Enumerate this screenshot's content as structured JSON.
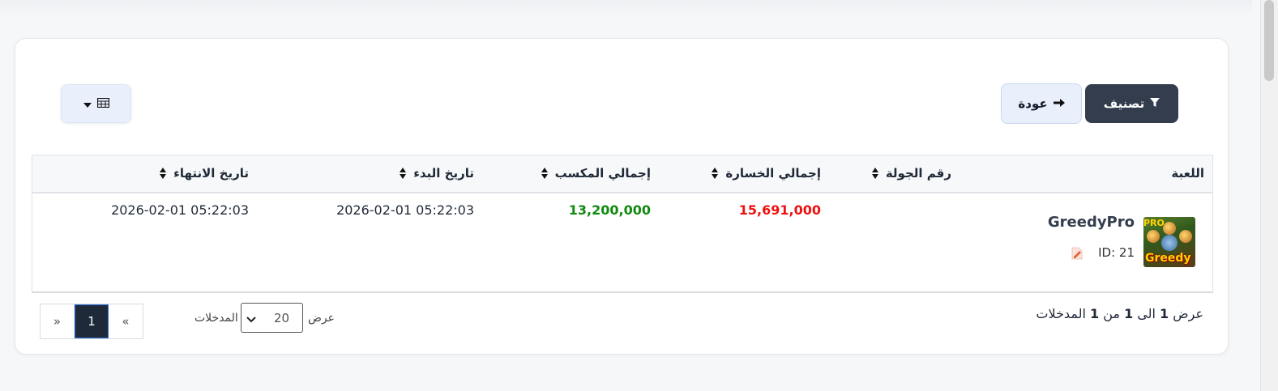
{
  "toolbar": {
    "filter_label": "تصنيف",
    "back_label": "عودة"
  },
  "table": {
    "headers": [
      "اللعبة",
      "رقم الجولة",
      "إجمالي الخسارة",
      "إجمالي المكسب",
      "تاريخ البدء",
      "تاريخ الانتهاء"
    ],
    "rows": [
      {
        "game_name": "GreedyPro",
        "game_id": "ID: 21",
        "thumb_pro": "PRO",
        "thumb_word": "Greedy",
        "round": "",
        "total_loss": "15,691,000",
        "total_win": "13,200,000",
        "start_date": "2026-02-01 05:22:03",
        "end_date": "2026-02-01 05:22:03"
      }
    ]
  },
  "footer": {
    "info_prefix": "عرض",
    "info_from": "1",
    "info_to_word": "الى",
    "info_to": "1",
    "info_of_word": "من",
    "info_total": "1",
    "info_suffix": "المدخلات",
    "length_show": "عرض",
    "length_value": "20",
    "length_entries": "المدخلات"
  },
  "pagination": {
    "prev": "«",
    "current": "1",
    "next": "»"
  },
  "colors": {
    "loss": "#ee1111",
    "win": "#108a10",
    "primary_button": "#333d4d",
    "secondary_button": "#e9effb"
  },
  "icons": {
    "filter": "funnel-icon",
    "back": "arrow-right-icon",
    "columns": "table-grid-icon",
    "edit": "edit-icon",
    "sort": "sort-icon"
  }
}
